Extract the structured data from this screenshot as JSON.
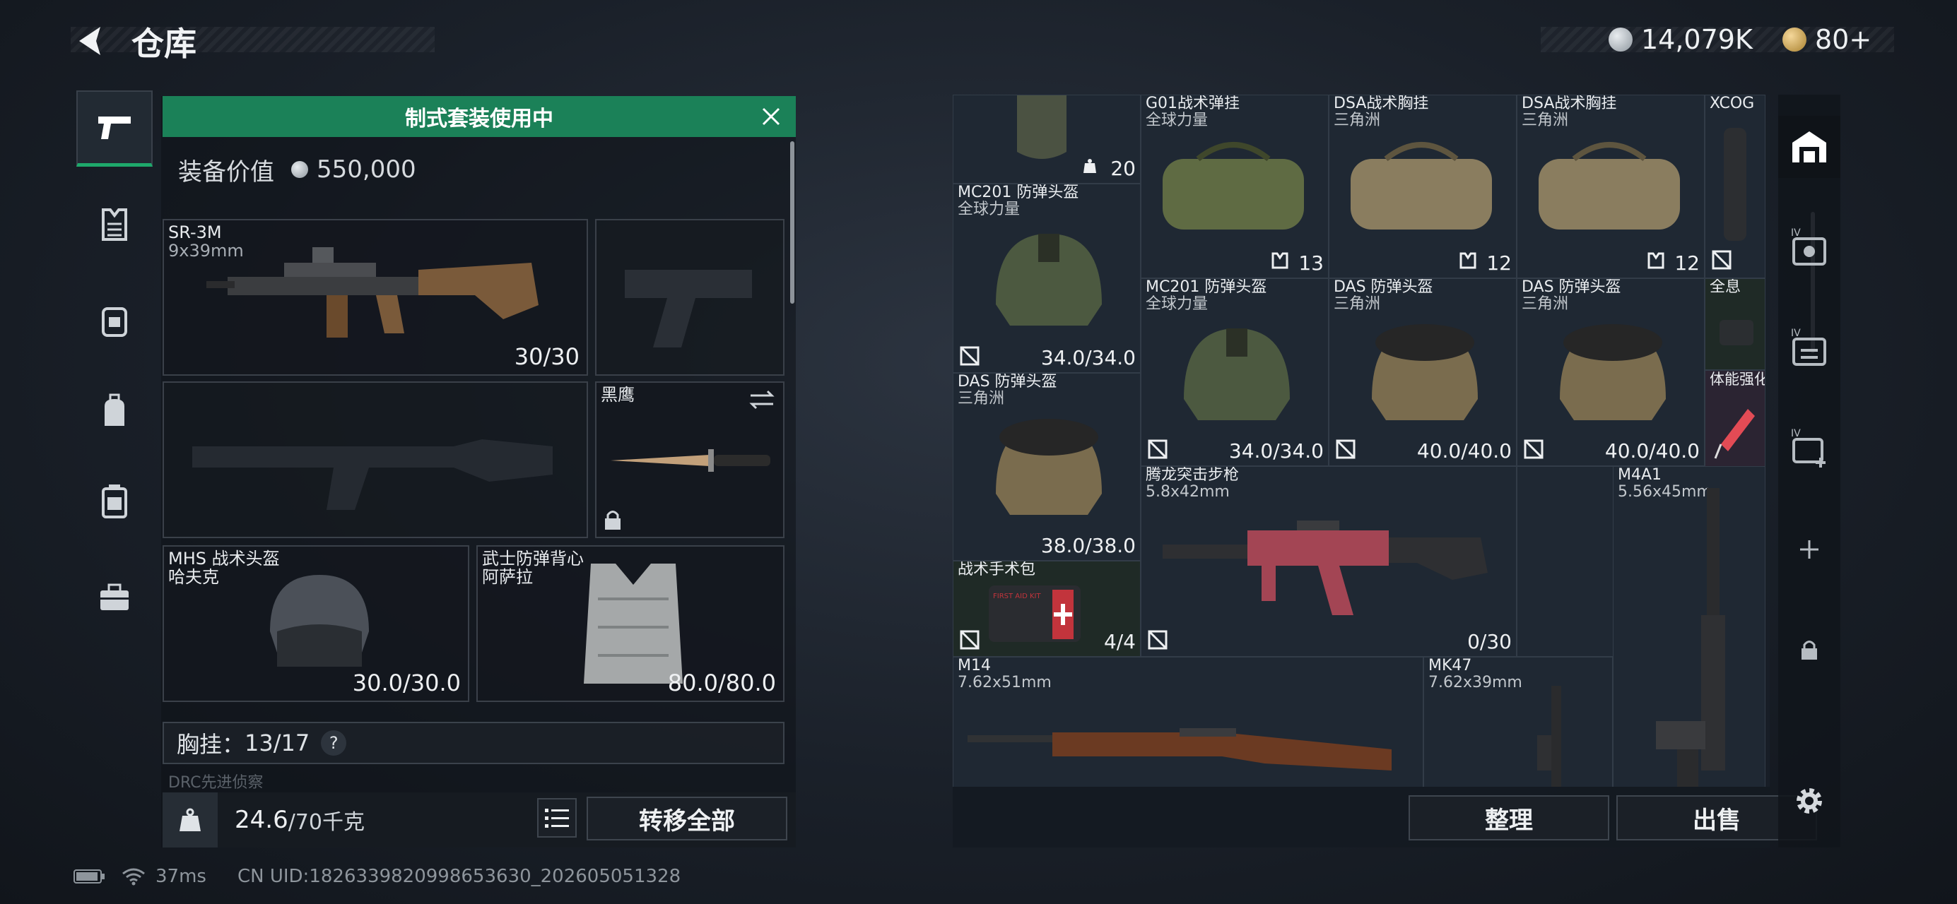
{
  "header": {
    "title": "仓库"
  },
  "currency": {
    "coins": "14,079K",
    "tickets": "80+",
    "colors": {
      "silver": "#c9ced3",
      "gold": "#c9a259"
    }
  },
  "sidebar": {
    "items": [
      {
        "icon": "pistol-icon",
        "active": true
      },
      {
        "icon": "armor-icon",
        "active": false
      },
      {
        "icon": "vest-icon",
        "active": false
      },
      {
        "icon": "backpack-icon",
        "active": false
      },
      {
        "icon": "case-icon",
        "active": false
      },
      {
        "icon": "toolbox-icon",
        "active": false
      }
    ]
  },
  "loadout": {
    "banner": "制式套装使用中",
    "value_label": "装备价值",
    "value": "550,000",
    "primary": {
      "name": "SR-3M",
      "caliber": "9x39mm",
      "ammo": "30/30"
    },
    "knife": {
      "name": "黑鹰"
    },
    "helmet": {
      "name": "MHS 战术头盔",
      "sub": "哈夫克",
      "durability": "30.0/30.0"
    },
    "armor": {
      "name": "武士防弹背心",
      "sub": "阿萨拉",
      "durability": "80.0/80.0"
    },
    "chest_rig": {
      "label": "胸挂：",
      "count": "13/17",
      "help": "?"
    },
    "peek": "DRC先进侦察",
    "weight": {
      "current": "24.6",
      "max": "/70千克"
    },
    "transfer_all": "转移全部"
  },
  "storage": {
    "items": [
      {
        "id": "bag0",
        "count": "20"
      },
      {
        "id": "g01",
        "name": "G01战术弹挂",
        "sub": "全球力量",
        "count": "13"
      },
      {
        "id": "dsa1",
        "name": "DSA战术胸挂",
        "sub": "三角洲",
        "count": "12"
      },
      {
        "id": "dsa2",
        "name": "DSA战术胸挂",
        "sub": "三角洲",
        "count": "12"
      },
      {
        "id": "xcog",
        "name": "XCOG"
      },
      {
        "id": "mc201a",
        "name": "MC201 防弹头盔",
        "sub": "全球力量",
        "dur": "34.0/34.0"
      },
      {
        "id": "mc201b",
        "name": "MC201 防弹头盔",
        "sub": "全球力量",
        "dur": "34.0/34.0"
      },
      {
        "id": "das1",
        "name": "DAS 防弹头盔",
        "sub": "三角洲",
        "dur": "40.0/40.0"
      },
      {
        "id": "das2",
        "name": "DAS 防弹头盔",
        "sub": "三角洲",
        "dur": "40.0/40.0"
      },
      {
        "id": "holo",
        "name": "全息"
      },
      {
        "id": "stim",
        "name": "体能强化剂"
      },
      {
        "id": "das3",
        "name": "DAS 防弹头盔",
        "sub": "三角洲",
        "dur": "38.0/38.0"
      },
      {
        "id": "tenglong",
        "name": "腾龙突击步枪",
        "sub": "5.8x42mm",
        "ammo": "0/30"
      },
      {
        "id": "m4a1",
        "name": "M4A1",
        "sub": "5.56x45mm"
      },
      {
        "id": "kit",
        "name": "战术手术包",
        "count": "4/4",
        "kit_text": "FIRST AID KIT"
      },
      {
        "id": "m14",
        "name": "M14",
        "sub": "7.62x51mm"
      },
      {
        "id": "mk47",
        "name": "MK47",
        "sub": "7.62x39mm"
      }
    ],
    "sort_button": "整理",
    "sell_button": "出售"
  },
  "right_column": {
    "items": [
      "storage-icon",
      "case-iv-icon",
      "case-iv-icon",
      "case-iv-add-icon",
      "add-icon",
      "lock-icon",
      "gear-icon"
    ],
    "case_tier": "IV"
  },
  "status": {
    "ping": "37ms",
    "uid": "CN UID:1826339820998653630_202605051328"
  }
}
